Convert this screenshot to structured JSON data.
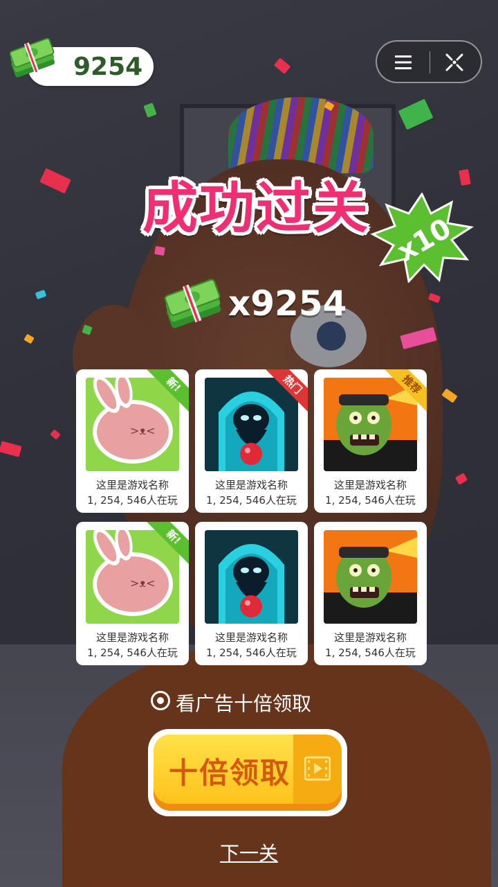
{
  "header": {
    "cash_amount": "9254",
    "cash_icon": "cash-stack-icon",
    "menu_icon": "menu-lines-icon",
    "close_icon": "target-close-icon"
  },
  "result": {
    "title": "成功过关",
    "multiplier_badge": "x10",
    "reward_icon": "cash-stack-icon",
    "reward_amount": "x9254"
  },
  "games": [
    {
      "name": "这里是游戏名称",
      "players": "1, 254, 546人在玩",
      "tag": "新!",
      "tag_color": "#5bbf2f",
      "art": "pink-bunny"
    },
    {
      "name": "这里是游戏名称",
      "players": "1, 254, 546人在玩",
      "tag": "热门",
      "tag_color": "#e03535",
      "art": "shadow-creature"
    },
    {
      "name": "这里是游戏名称",
      "players": "1, 254, 546人在玩",
      "tag": "推荐",
      "tag_color": "#f5c021",
      "art": "zombie"
    },
    {
      "name": "这里是游戏名称",
      "players": "1, 254, 546人在玩",
      "tag": "新!",
      "tag_color": "#5bbf2f",
      "art": "pink-bunny"
    },
    {
      "name": "这里是游戏名称",
      "players": "1, 254, 546人在玩",
      "tag": "",
      "tag_color": "",
      "art": "shadow-creature"
    },
    {
      "name": "这里是游戏名称",
      "players": "1, 254, 546人在玩",
      "tag": "",
      "tag_color": "",
      "art": "zombie"
    }
  ],
  "ad_option": {
    "label": "看广告十倍领取",
    "selected": true
  },
  "claim_button": {
    "label": "十倍领取",
    "icon": "video-play-icon"
  },
  "next_link": "下一关",
  "colors": {
    "title": "#f02e72",
    "burst": "#5bbf2f",
    "claim_bg": "#ffc21a",
    "claim_text": "#d35a0d"
  }
}
